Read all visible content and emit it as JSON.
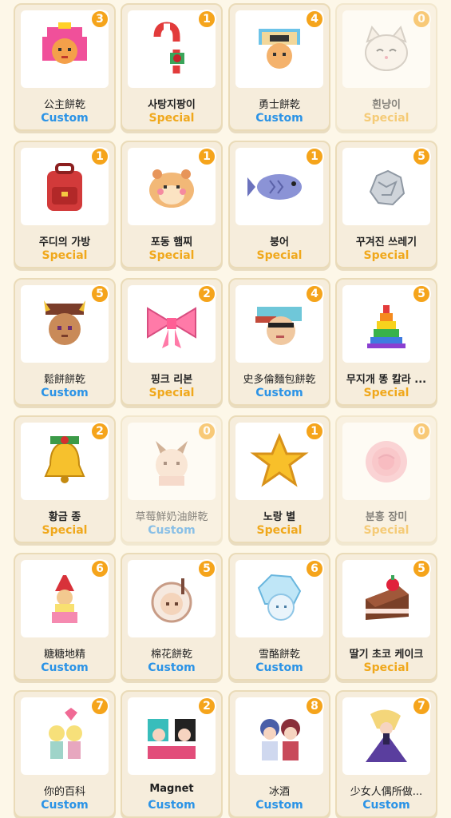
{
  "colors": {
    "custom": "#2b93e6",
    "special": "#f0a81c",
    "badge": "#f5a41b",
    "card_bg": "#f6eddc",
    "page_bg": "#fdf7e8"
  },
  "items": [
    {
      "name": "公主餅乾",
      "type": "Custom",
      "count": "3",
      "icon": "princess-cookie-icon",
      "dim": false,
      "bold": false
    },
    {
      "name": "사탕지팡이",
      "type": "Special",
      "count": "1",
      "icon": "candy-cane-icon",
      "dim": false,
      "bold": true
    },
    {
      "name": "勇士餅乾",
      "type": "Custom",
      "count": "4",
      "icon": "warrior-cookie-icon",
      "dim": false,
      "bold": false
    },
    {
      "name": "흰냥이",
      "type": "Special",
      "count": "0",
      "icon": "white-cat-icon",
      "dim": true,
      "bold": true
    },
    {
      "name": "주디의 가방",
      "type": "Special",
      "count": "1",
      "icon": "red-backpack-icon",
      "dim": false,
      "bold": true
    },
    {
      "name": "포동 햄찌",
      "type": "Special",
      "count": "1",
      "icon": "hamster-icon",
      "dim": false,
      "bold": true
    },
    {
      "name": "붕어",
      "type": "Special",
      "count": "1",
      "icon": "fish-bun-icon",
      "dim": false,
      "bold": true
    },
    {
      "name": "꾸겨진 쓰레기",
      "type": "Special",
      "count": "5",
      "icon": "crumpled-trash-icon",
      "dim": false,
      "bold": true
    },
    {
      "name": "鬆餅餅乾",
      "type": "Custom",
      "count": "5",
      "icon": "pancake-cookie-icon",
      "dim": false,
      "bold": false
    },
    {
      "name": "핑크 리본",
      "type": "Special",
      "count": "2",
      "icon": "pink-ribbon-icon",
      "dim": false,
      "bold": true
    },
    {
      "name": "史多倫麵包餅乾",
      "type": "Custom",
      "count": "4",
      "icon": "stollen-cookie-icon",
      "dim": false,
      "bold": false
    },
    {
      "name": "무지개 똥 칼라 ...",
      "type": "Special",
      "count": "5",
      "icon": "rainbow-poop-icon",
      "dim": false,
      "bold": true
    },
    {
      "name": "황금 종",
      "type": "Special",
      "count": "2",
      "icon": "golden-bell-icon",
      "dim": false,
      "bold": true
    },
    {
      "name": "草莓鮮奶油餅乾",
      "type": "Custom",
      "count": "0",
      "icon": "strawberry-cream-cookie-icon",
      "dim": true,
      "bold": false
    },
    {
      "name": "노랑 별",
      "type": "Special",
      "count": "1",
      "icon": "yellow-star-icon",
      "dim": false,
      "bold": true
    },
    {
      "name": "분홍 장미",
      "type": "Special",
      "count": "0",
      "icon": "pink-rose-icon",
      "dim": true,
      "bold": true
    },
    {
      "name": "糖糖地精",
      "type": "Custom",
      "count": "6",
      "icon": "candy-gnome-icon",
      "dim": false,
      "bold": false
    },
    {
      "name": "棉花餅乾",
      "type": "Custom",
      "count": "5",
      "icon": "cotton-cookie-icon",
      "dim": false,
      "bold": false
    },
    {
      "name": "雪酪餅乾",
      "type": "Custom",
      "count": "6",
      "icon": "sherbet-cookie-icon",
      "dim": false,
      "bold": false
    },
    {
      "name": "딸기 초코 케이크",
      "type": "Special",
      "count": "5",
      "icon": "strawberry-choco-cake-icon",
      "dim": false,
      "bold": true
    },
    {
      "name": "你的百科",
      "type": "Custom",
      "count": "7",
      "icon": "twins-icon",
      "dim": false,
      "bold": false
    },
    {
      "name": "Magnet",
      "type": "Custom",
      "count": "2",
      "icon": "magnet-duo-icon",
      "dim": false,
      "bold": true
    },
    {
      "name": "冰酒",
      "type": "Custom",
      "count": "8",
      "icon": "ice-wine-duo-icon",
      "dim": false,
      "bold": false
    },
    {
      "name": "少女人偶所做...",
      "type": "Custom",
      "count": "7",
      "icon": "doll-girl-icon",
      "dim": false,
      "bold": false
    }
  ]
}
